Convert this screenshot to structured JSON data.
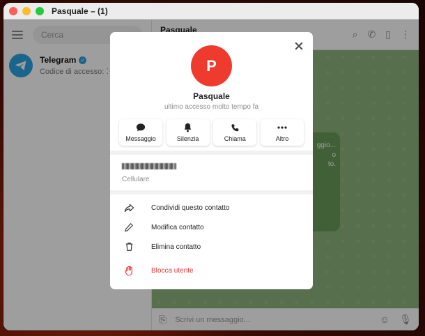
{
  "window": {
    "title": "Pasquale – (1)"
  },
  "sidebar": {
    "search_placeholder": "Cerca",
    "chats": [
      {
        "name": "Telegram",
        "preview": "Codice di accesso: ⁚⁖⁚⁚"
      }
    ]
  },
  "main": {
    "title": "Pasquale",
    "bubble_lines": [
      "ggio...",
      "o",
      "to."
    ],
    "composer_placeholder": "Scrivi un messaggio..."
  },
  "profile": {
    "avatar_letter": "P",
    "name": "Pasquale",
    "status": "ultimo accesso molto tempo fa",
    "actions": [
      {
        "label": "Messaggio",
        "icon": "message-icon"
      },
      {
        "label": "Silenzia",
        "icon": "bell-icon"
      },
      {
        "label": "Chiama",
        "icon": "phone-icon"
      },
      {
        "label": "Altro",
        "icon": "more-icon"
      }
    ],
    "phone_label": "Cellulare",
    "menu": [
      {
        "label": "Condividi questo contatto",
        "icon": "share-icon"
      },
      {
        "label": "Modifica contatto",
        "icon": "pencil-icon"
      },
      {
        "label": "Elimina contatto",
        "icon": "trash-icon"
      },
      {
        "label": "Blocca utente",
        "icon": "hand-icon",
        "danger": true
      }
    ]
  },
  "colors": {
    "avatar": "#ee3b2d",
    "danger": "#e53935",
    "telegram": "#2aa3e0"
  }
}
